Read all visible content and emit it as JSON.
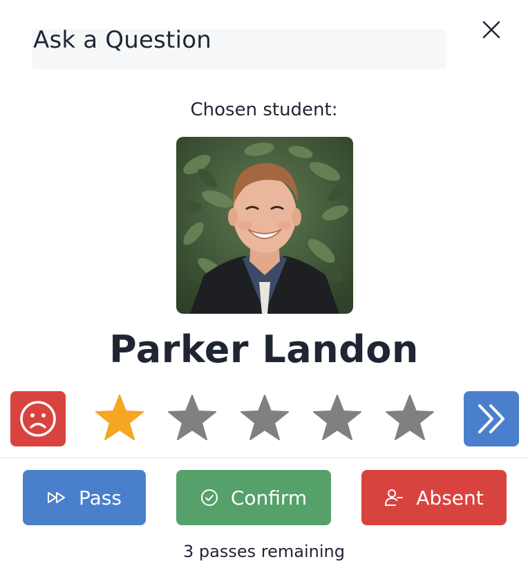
{
  "modal": {
    "title": "Ask a Question",
    "close_icon": "close-icon"
  },
  "student": {
    "chosen_label": "Chosen student:",
    "name": "Parker Landon",
    "photo_icon": "student-photo"
  },
  "rating": {
    "sad_icon": "sad-face-icon",
    "next_icon": "double-chevron-right-icon",
    "max_stars": 5,
    "selected_stars": 1,
    "active_color": "#f5a623",
    "inactive_color": "#808080"
  },
  "actions": {
    "pass_label": "Pass",
    "pass_icon": "fast-forward-icon",
    "confirm_label": "Confirm",
    "confirm_icon": "check-circle-icon",
    "absent_label": "Absent",
    "absent_icon": "user-minus-icon"
  },
  "status": {
    "passes_remaining": "3 passes remaining"
  },
  "colors": {
    "primary_blue": "#4a7fcc",
    "success_green": "#56a06a",
    "danger_red": "#d9433f",
    "text_dark": "#1f2533"
  }
}
